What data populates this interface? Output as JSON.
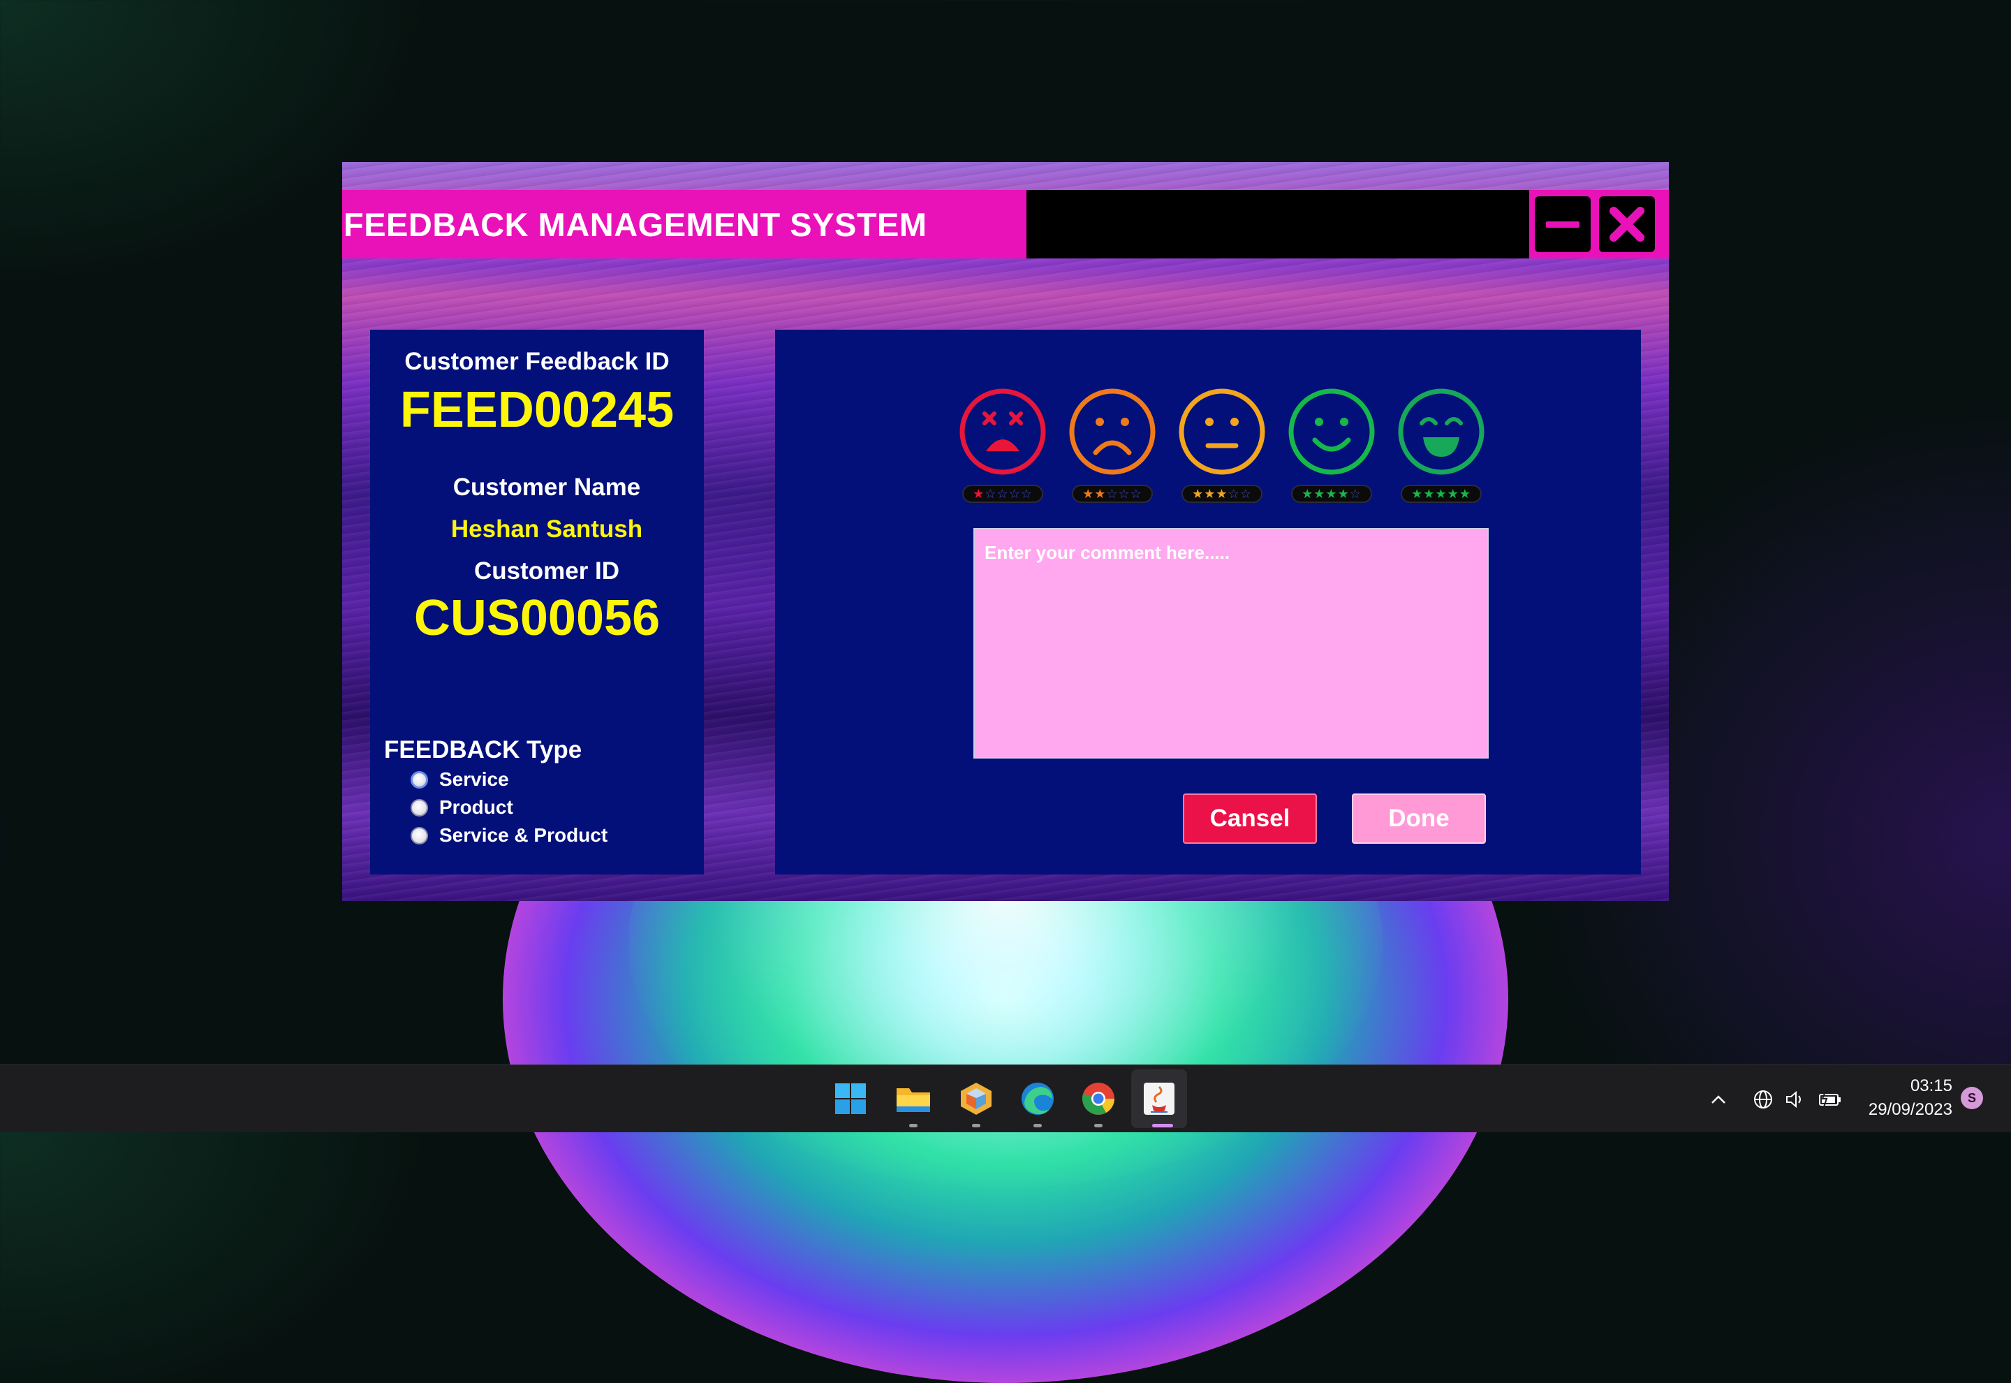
{
  "window": {
    "title": "FEEDBACK MANAGEMENT SYSTEM",
    "minimize_icon": "minus-icon",
    "close_icon": "x-close-icon",
    "accent": "#e812b8",
    "panel_color": "#03107a"
  },
  "left_panel": {
    "feedback_id_label": "Customer Feedback ID",
    "feedback_id_value": "FEED00245",
    "customer_name_label": "Customer Name",
    "customer_name_value": "Heshan Santush",
    "customer_id_label": "Customer ID",
    "customer_id_value": "CUS00056",
    "feedback_type_label": "FEEDBACK Type",
    "feedback_type_options": [
      "Service",
      "Product",
      "Service & Product"
    ],
    "value_color": "#fdf50a"
  },
  "rating": {
    "options": [
      {
        "icon": "dizzy-face-icon",
        "stars": 1,
        "color": "#e8163a"
      },
      {
        "icon": "sad-face-icon",
        "stars": 2,
        "color": "#f07a1a"
      },
      {
        "icon": "neutral-face-icon",
        "stars": 3,
        "color": "#f2a51d"
      },
      {
        "icon": "smile-face-icon",
        "stars": 4,
        "color": "#16b84a"
      },
      {
        "icon": "grin-face-icon",
        "stars": 5,
        "color": "#17a85a"
      }
    ],
    "max_stars": 5
  },
  "comment": {
    "placeholder": "Enter your comment here.....",
    "value": ""
  },
  "buttons": {
    "cancel_label": "Cansel",
    "done_label": "Done"
  },
  "taskbar": {
    "apps": [
      "windows-start-icon",
      "file-explorer-icon",
      "app-cube-icon",
      "edge-browser-icon",
      "chrome-browser-icon",
      "java-app-icon"
    ],
    "time": "03:15",
    "date": "29/09/2023",
    "user_badge": "S"
  }
}
